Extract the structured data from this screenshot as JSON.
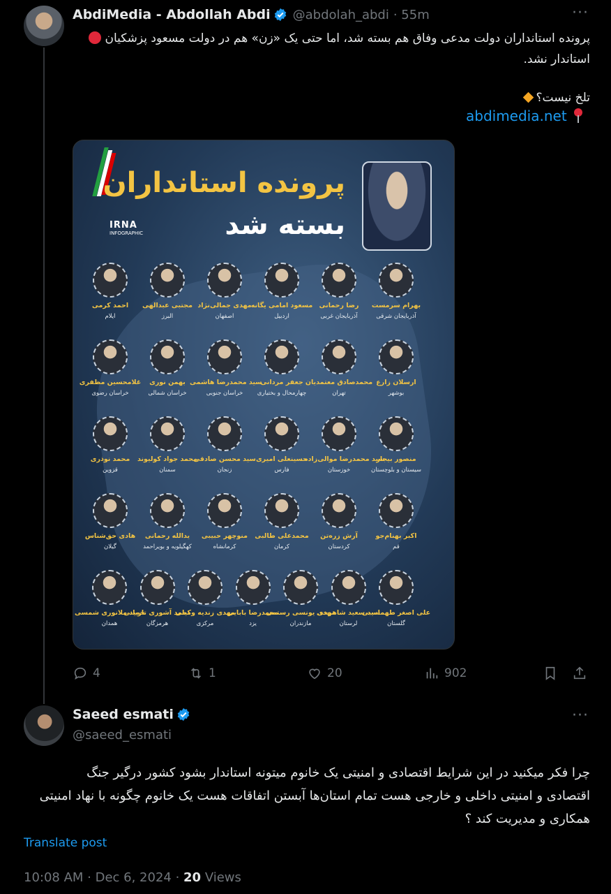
{
  "tweet1": {
    "author_name": "AbdiMedia - Abdollah Abdi",
    "handle": "@abdolah_abdi",
    "time": "· 55m",
    "text_line1": "پرونده استانداران دولت مدعی وفاق هم بسته شد، اما حتی یک «زن» هم در دولت مسعود پزشکیان",
    "text_line2": "استاندار نشد.",
    "text_line3": "تلخ نیست؟",
    "link": "abdimedia.net",
    "image": {
      "title_line1": "پرونده استانداران",
      "title_line2": "بسته شد",
      "logo": "IRNA",
      "logo_sub": "INFOGRAPHIC",
      "people": [
        {
          "name": "بهرام سرمست",
          "province": "آذربایجان شرقی"
        },
        {
          "name": "رضا رحمانی",
          "province": "آذربایجان غربی"
        },
        {
          "name": "مسعود امامی یگانه",
          "province": "اردبیل"
        },
        {
          "name": "مهدی جمالی‌نژاد",
          "province": "اصفهان"
        },
        {
          "name": "مجتبی عبدالهی",
          "province": "البرز"
        },
        {
          "name": "احمد کرمی",
          "province": "ایلام"
        },
        {
          "name": "ارسلان زارع",
          "province": "بوشهر"
        },
        {
          "name": "محمدصادق معتمدیان",
          "province": "تهران"
        },
        {
          "name": "جعفر مردانی",
          "province": "چهارمحال و بختیاری"
        },
        {
          "name": "سید محمدرضا هاشمی",
          "province": "خراسان جنوبی"
        },
        {
          "name": "بهمن نوری",
          "province": "خراسان شمالی"
        },
        {
          "name": "غلامحسین مظفری",
          "province": "خراسان رضوی"
        },
        {
          "name": "منصور بیجار",
          "province": "سیستان و بلوچستان"
        },
        {
          "name": "سید محمدرضا موالی‌زاده",
          "province": "خوزستان"
        },
        {
          "name": "حسینعلی امیری",
          "province": "فارس"
        },
        {
          "name": "سید محسن صادقی",
          "province": "زنجان"
        },
        {
          "name": "محمد جواد کولیوند",
          "province": "سمنان"
        },
        {
          "name": "محمد نوذری",
          "province": "قزوین"
        },
        {
          "name": "اکبر بهنام‌جو",
          "province": "قم"
        },
        {
          "name": "آرش زره‌تن",
          "province": "کردستان"
        },
        {
          "name": "محمدعلی طالبی",
          "province": "کرمان"
        },
        {
          "name": "منوچهر حبیبی",
          "province": "کرمانشاه"
        },
        {
          "name": "یدالله رحمانی",
          "province": "کهگیلویه و بویراحمد"
        },
        {
          "name": "هادی حق‌شناس",
          "province": "گیلان"
        },
        {
          "name": "علی اصغر طهماسبی",
          "province": "گلستان"
        },
        {
          "name": "سید سعید شاهرخی",
          "province": "لرستان"
        },
        {
          "name": "مهدی یونسی رستمی",
          "province": "مازندران"
        },
        {
          "name": "محمدرضا بابایی",
          "province": "یزد"
        },
        {
          "name": "مهدی زندیه وکیلی",
          "province": "مرکزی"
        },
        {
          "name": "محمد آشوری تازیانی",
          "province": "هرمزگان"
        },
        {
          "name": "حمید ملانوری شمسی",
          "province": "همدان"
        }
      ]
    },
    "stats": {
      "replies": "4",
      "reposts": "1",
      "likes": "20",
      "views": "902"
    }
  },
  "tweet2": {
    "author_name": "Saeed esmati",
    "handle": "@saeed_esmati",
    "text_line1": "چرا فکر میکنید در این شرایط اقتصادی و امنیتی یک خانوم میتونه استاندار بشود کشور درگیر جنگ",
    "text_line2": "اقتصادی و امنیتی داخلی و خارجی هست تمام استان‌ها آبستن اتفاقات هست یک خانوم چگونه با نهاد امنیتی",
    "text_line3": "همکاری و مدیریت کند ؟",
    "translate": "Translate post",
    "timestamp": "10:08 AM · Dec 6, 2024 · ",
    "views_count": "20",
    "views_label": " Views"
  },
  "colors": {
    "verified": "#1d9bf0",
    "link": "#1d9bf0",
    "muted": "#71767b",
    "gold": "#f3c443"
  }
}
